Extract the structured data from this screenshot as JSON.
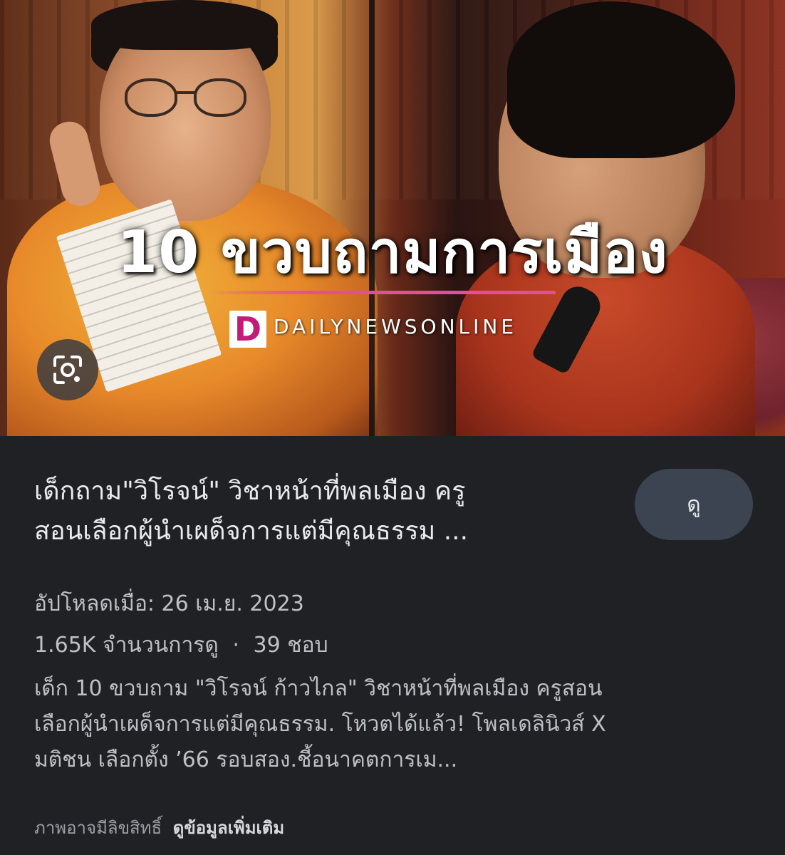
{
  "thumbnail": {
    "headline": "10 ขวบถามการเมือง",
    "logo_letter": "D",
    "logo_text": "DAILYNEWSONLINE",
    "accent_color": "#e0509a"
  },
  "lens_button": {
    "icon": "google-lens-icon"
  },
  "result": {
    "title_line1": "เด็กถาม\"วิโรจน์\" วิชาหน้าที่พลเมือง ครู",
    "title_line2": "สอนเลือกผู้นำเผด็จการแต่มีคุณธรรม ...",
    "view_label": "ดู",
    "upload": "อัปโหลดเมื่อ: 26 เม.ย. 2023",
    "views": "1.65K จำนวนการดู",
    "separator": "·",
    "likes": "39 ชอบ",
    "description_line1": "เด็ก 10 ขวบถาม \"วิโรจน์ ก้าวไกล\" วิชาหน้าที่พลเมือง ครูสอน",
    "description_line2": "เลือกผู้นำเผด็จการแต่มีคุณธรรม. โหวตได้แล้ว! โพลเดลินิวส์ X",
    "description_line3": "มติชน เลือกตั้ง ’66 รอบสอง.ชี้อนาคตการเม...",
    "copyright_note": "ภาพอาจมีลิขสิทธิ์",
    "more_info_link": "ดูข้อมูลเพิ่มเติม"
  }
}
